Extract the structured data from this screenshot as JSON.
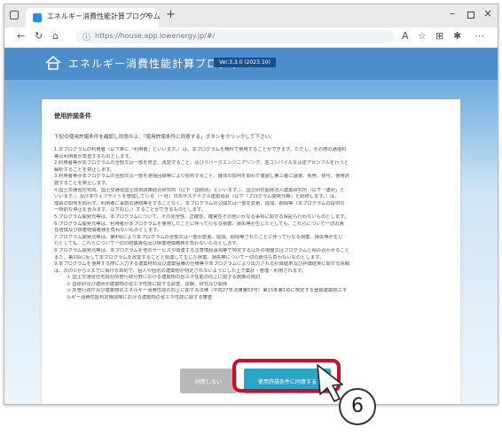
{
  "browser": {
    "tab_title": "エネルギー消費性能計算プログラム",
    "tab_close": "×",
    "new_tab": "+",
    "url": "https://house.app.lowenergy.jp/#/",
    "window_min": "–",
    "window_close": "×",
    "icons": [
      "back-icon",
      "refresh-icon",
      "home-icon",
      "info-icon",
      "read-aloud-icon",
      "favorites-icon",
      "collections-icon",
      "extensions-icon",
      "more-icon"
    ]
  },
  "app": {
    "title": "エネルギー消費性能計算プログラム",
    "version": "Ver.3.3.0 (2023.10)"
  },
  "terms": {
    "heading": "使用許諾条件",
    "intro": "下記の使用許諾条件を確認し同意の上、「使用許諾条件に同意する」ボタンをクリックして下さい。",
    "items": [
      "1.本プログラムの利用者（以下単に「利用者」といいます。）は、本プログラムを無料で使用することができます。ただし、その際の通信料",
      "等は利用者が負担するものとします。",
      "2.利用者等が本プログラムの全部又は一部を修正、改変すること、及びリバースエンジニアリング、逆コンパイル又は逆アセンブルを行うと",
      "解析することを禁止します。",
      "3.利用者等が本プログラムの全部又は一部を通信回線等により頒布すること、媒体の如何を問わず複製し第三者に譲渡、販売、貸与、使用許",
      "諾することを禁止します。",
      "4.国土交通省住宅局、国土交通省国土技術政策総合研究所（以下「国総研」といいます。）、国立研究開発法人建築研究所（以下「建研」と",
      "いいます。）及び本ウェブサイトを管理している（一社）日本サステナブル建築協会（以下「プログラム開発元等」と総称します。）は、",
      "理由の如何を問わず、利用者に事前の通知等をすることなく、本プログラムの公開又は一部を変更、追加、削除等（本プログラムの提供の",
      "一時的な停止を含みます。以下同じ。）することができるものとします。",
      "5.プログラム開発元等は、本プログラムについて、その完全性、正確性、確実性その他いかなる事項に関する保証も行わないものとします。",
      "6.プログラム開発元等は、利用者が本プログラムを使用したことに伴って行なる損害、損失等が生じたとしても、これらについて一切の責",
      "任賠償及び損害賠償義務を負わないものとします。",
      "7.プログラム開発元等は、第4項により本プログラムの全部又は一部が変更、追加、削除等されたことに伴って行なる損害、損失等が生じ",
      "たとしても、これらについて一切の賠償責任及び損害賠償義務を負わないものとします。",
      "8.プログラム開発元等は、本プログラムを他のサービスや関連する注意喚起事項等で特定する以外の場面又はプログラムと組み合わせること",
      "また、第2項に反して本プログラムを改変することと関連して生じた損害、損失等について一切の責任も負わないものとします。",
      "9.本プログラムを使用する際に入力する建築材料及び建築設備の仕様等や本プログラムにより出力される計算結果及び評価結果に関する情報",
      "は、次の①から③までに掲げる目的で、個人や個別の建築物が特定されないようにした上で集計・管理・利用されます。"
    ],
    "subitems": [
      "① 国土交通省住宅局が所管行政分野における建築物の省エネ性能の向上に関する施策の検討",
      "② 国総研及び建研が建築物の省エネ性能に関する調査、試験、研究及び開発",
      "③ 所管行政庁及び建築物のエネルギー消費性能の向上に関する法律（平成27年法律第53号）第15条第1項に規定する登録建築物エネ",
      "ルギー消費性能判定機関等における建築物の省エネ性能に関する審査"
    ],
    "decline_label": "同意しない",
    "agree_label": "使用許諾条件に同意する"
  },
  "annotation": {
    "step_number": "6",
    "highlight_color": "#c8102e"
  }
}
